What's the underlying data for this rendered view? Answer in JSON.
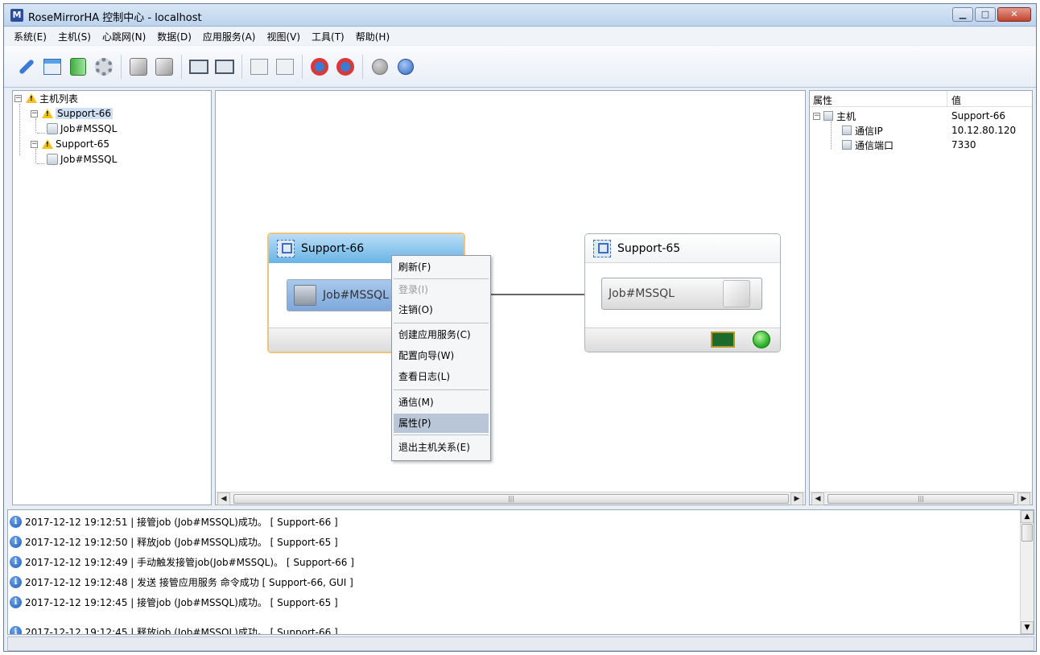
{
  "window": {
    "title": "RoseMirrorHA 控制中心  -  localhost",
    "app_icon": "M",
    "minimize": "▁",
    "maximize": "□",
    "close": "✕"
  },
  "menu": [
    "系统(E)",
    "主机(S)",
    "心跳网(N)",
    "数据(D)",
    "应用服务(A)",
    "视图(V)",
    "工具(T)",
    "帮助(H)"
  ],
  "toolbar": {
    "icons": [
      "key-icon",
      "settings-window-icon",
      "green-box-icon",
      "gears-icon",
      "cube-down-icon",
      "cube-up-icon",
      "monitor-down-icon",
      "monitor-up-icon",
      "folder-export-icon",
      "folder-import-icon",
      "lifebuoy-icon",
      "lifebuoy-clock-icon",
      "arrow-circle-icon",
      "help-icon"
    ]
  },
  "tree": {
    "root": "主机列表",
    "hosts": [
      {
        "name": "Support-66",
        "job": "Job#MSSQL"
      },
      {
        "name": "Support-65",
        "job": "Job#MSSQL"
      }
    ],
    "collapse_glyph": "−"
  },
  "canvas": {
    "active_host": {
      "name": "Support-66",
      "job": "Job#MSSQL"
    },
    "standby_host": {
      "name": "Support-65",
      "job": "Job#MSSQL"
    },
    "status_color": "#2db52d"
  },
  "context_menu": {
    "items": [
      "刷新(F)",
      "登录(I)",
      "注销(O)",
      "创建应用服务(C)",
      "配置向导(W)",
      "查看日志(L)",
      "通信(M)",
      "属性(P)",
      "退出主机关系(E)"
    ]
  },
  "properties": {
    "col_property": "属性",
    "col_value": "值",
    "group": {
      "name": "主机",
      "value": "Support-66"
    },
    "rows": [
      {
        "name": "通信IP",
        "value": "10.12.80.120"
      },
      {
        "name": "通信端口",
        "value": "7330"
      }
    ]
  },
  "log": {
    "entries": [
      "2017-12-12 19:12:51  |  接管job (Job#MSSQL)成功。    [ Support-66 ]",
      "2017-12-12 19:12:50  |  释放job (Job#MSSQL)成功。    [ Support-65 ]",
      "2017-12-12 19:12:49  |  手动触发接管job(Job#MSSQL)。    [ Support-66 ]",
      "2017-12-12 19:12:48  |  发送 接管应用服务 命令成功   [ Support-66, GUI ]",
      "2017-12-12 19:12:45  |  接管job (Job#MSSQL)成功。    [ Support-65 ]",
      "2017-12-12 19:12:45  |  释放job (Job#MSSQL)成功。    [ Support-66 ]"
    ]
  },
  "scroll": {
    "left": "◀",
    "right": "▶",
    "up": "▲",
    "down": "▼",
    "grip": "|||"
  }
}
